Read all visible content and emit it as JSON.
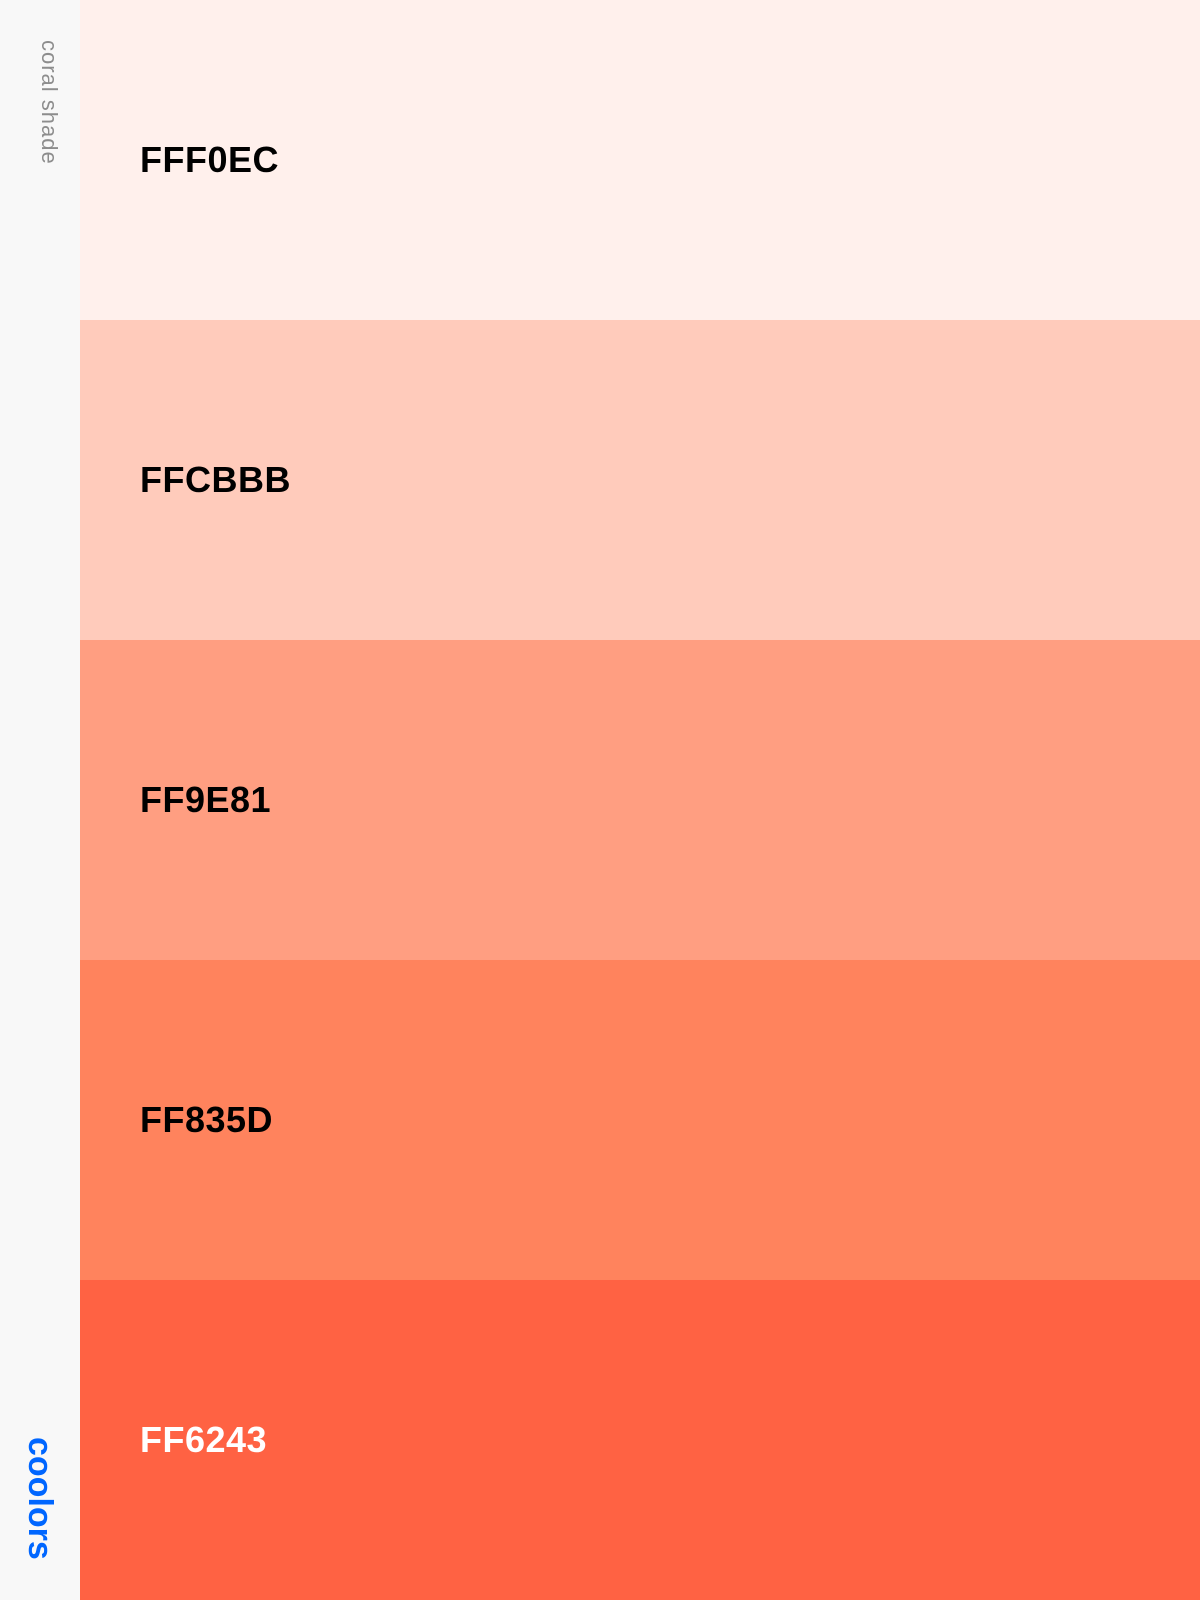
{
  "sidebar": {
    "palette_name": "coral shade",
    "brand": "coolors",
    "brand_color": "#0066ff",
    "palette_name_color": "#8d8d8d"
  },
  "swatches": [
    {
      "hex": "FFF0EC",
      "color": "#FFF0EC",
      "text_color": "#000000"
    },
    {
      "hex": "FFCBBB",
      "color": "#FFCBBB",
      "text_color": "#000000"
    },
    {
      "hex": "FF9E81",
      "color": "#FF9E81",
      "text_color": "#000000"
    },
    {
      "hex": "FF835D",
      "color": "#FF835D",
      "text_color": "#000000"
    },
    {
      "hex": "FF6243",
      "color": "#FF6243",
      "text_color": "#ffffff"
    }
  ]
}
